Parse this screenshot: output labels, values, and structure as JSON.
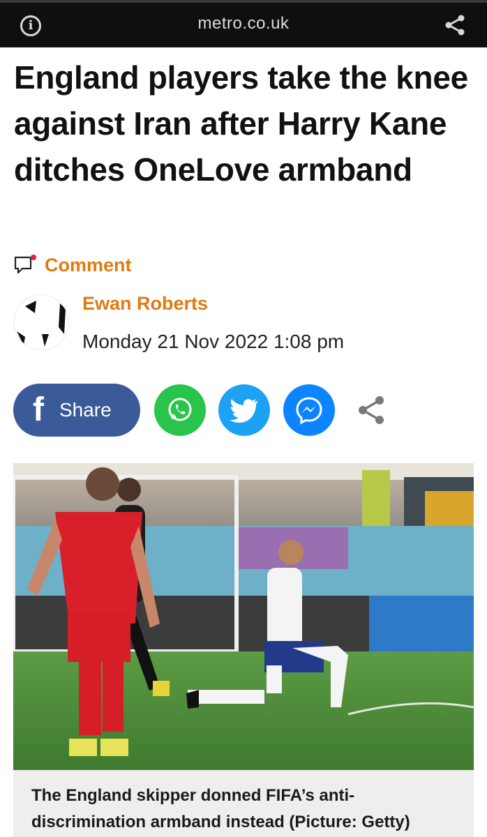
{
  "browser": {
    "site": "metro.co.uk",
    "info_icon": "info-icon",
    "share_icon": "share-icon"
  },
  "article": {
    "headline": "England players take the knee against Iran after Harry Kane ditches OneLove armband",
    "comment_label": "Comment",
    "author": "Ewan Roberts",
    "timestamp": "Monday 21 Nov 2022 1:08 pm",
    "caption": "The England skipper donned FIFA’s anti-discrimination armband instead (Picture: Getty)"
  },
  "share_bar": {
    "facebook_label": "Share",
    "buttons": [
      "facebook-icon",
      "whatsapp-icon",
      "twitter-icon",
      "messenger-icon",
      "share-icon"
    ]
  },
  "colors": {
    "accent": "#e07b12",
    "facebook": "#3b5a9a",
    "whatsapp": "#29c44b",
    "twitter": "#1da1f2",
    "messenger": "#0d84ff",
    "topbar": "#0f0f0f"
  }
}
